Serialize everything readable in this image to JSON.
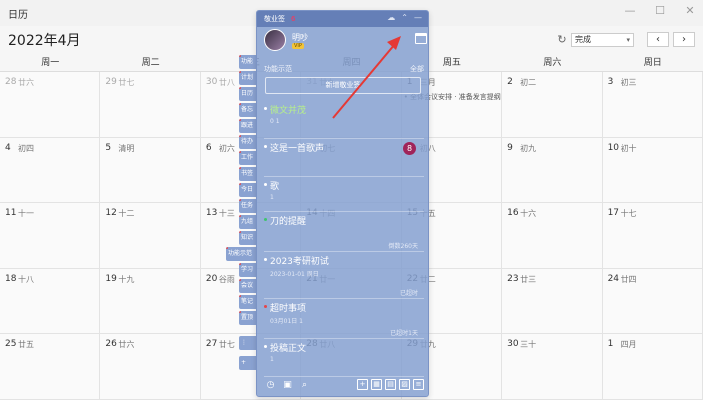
{
  "window": {
    "title": "日历",
    "controls": [
      "—",
      "☐",
      "✕"
    ]
  },
  "header": {
    "month_title": "2022年4月",
    "view_select": "完成",
    "prev": "‹",
    "next": "›",
    "refresh": "↻"
  },
  "weekdays": [
    "周一",
    "周二",
    "周三",
    "周四",
    "周五",
    "周六",
    "周日"
  ],
  "rows": [
    [
      {
        "d": "28",
        "l": "廿六",
        "prev": true
      },
      {
        "d": "29",
        "l": "廿七",
        "prev": true
      },
      {
        "d": "30",
        "l": "廿八",
        "prev": true
      },
      {
        "d": "31",
        "l": "廿九",
        "prev": true
      },
      {
        "d": "1",
        "l": "三月"
      },
      {
        "d": "2",
        "l": "初二"
      },
      {
        "d": "3",
        "l": "初三"
      }
    ],
    [
      {
        "d": "4",
        "l": "初四"
      },
      {
        "d": "5",
        "l": "清明"
      },
      {
        "d": "6",
        "l": "初六"
      },
      {
        "d": "7",
        "l": "初七"
      },
      {
        "d": "8",
        "l": "初八"
      },
      {
        "d": "9",
        "l": "初九"
      },
      {
        "d": "10",
        "l": "初十"
      }
    ],
    [
      {
        "d": "11",
        "l": "十一"
      },
      {
        "d": "12",
        "l": "十二"
      },
      {
        "d": "13",
        "l": "十三"
      },
      {
        "d": "14",
        "l": "十四"
      },
      {
        "d": "15",
        "l": "十五"
      },
      {
        "d": "16",
        "l": "十六"
      },
      {
        "d": "17",
        "l": "十七"
      }
    ],
    [
      {
        "d": "18",
        "l": "十八"
      },
      {
        "d": "19",
        "l": "十九"
      },
      {
        "d": "20",
        "l": "谷雨"
      },
      {
        "d": "21",
        "l": "廿一"
      },
      {
        "d": "22",
        "l": "廿二"
      },
      {
        "d": "23",
        "l": "廿三"
      },
      {
        "d": "24",
        "l": "廿四"
      }
    ],
    [
      {
        "d": "25",
        "l": "廿五"
      },
      {
        "d": "26",
        "l": "廿六"
      },
      {
        "d": "27",
        "l": "廿七"
      },
      {
        "d": "28",
        "l": "廿八"
      },
      {
        "d": "29",
        "l": "廿九"
      },
      {
        "d": "30",
        "l": "三十"
      },
      {
        "d": "1",
        "l": "四月"
      }
    ]
  ],
  "cell_event": "• 全体会议安排 · 准备发言提纲",
  "notes_panel": {
    "title": "敬业签",
    "count": "6",
    "username": "明吵",
    "vip": "VIP",
    "section_label": "功能示范",
    "filter": "全部",
    "new_note": "新增敬业签",
    "notes": [
      {
        "title": "微文并茂",
        "meta": "0  1",
        "right": ""
      },
      {
        "title": "这是一首歌声",
        "meta": "",
        "right": ""
      },
      {
        "title": "歌",
        "meta": "1",
        "right": ""
      },
      {
        "title": "刀的提醒",
        "meta": "",
        "right": "倒数260天"
      },
      {
        "title": "2023考研初试",
        "meta": "2023-01-01 周日",
        "right": "已超时"
      },
      {
        "title": "超时事项",
        "meta": "03月01日  1",
        "right": "已超时1天"
      },
      {
        "title": "投稿正文",
        "meta": "1",
        "right": ""
      }
    ]
  },
  "side_tabs": [
    "功能",
    "计划",
    "日历",
    "备忘",
    "跟进",
    "待办",
    "工作",
    "书签",
    "今日",
    "任务",
    "九组",
    "知识",
    "功能示范",
    "学习",
    "会议",
    "笔记",
    "置顶",
    "⋮",
    "+"
  ],
  "badge": "8"
}
